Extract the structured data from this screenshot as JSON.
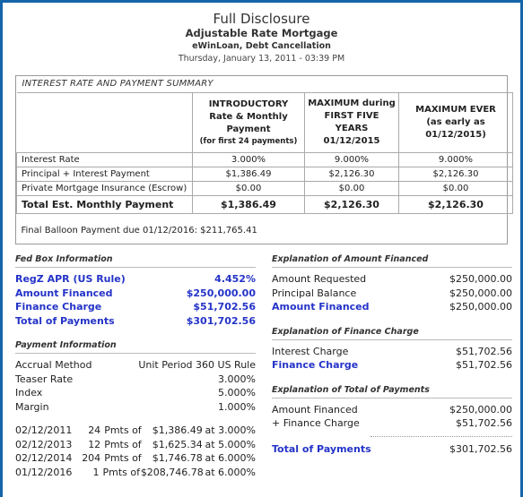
{
  "document": {
    "title": "Full Disclosure",
    "subtitle": "Adjustable Rate Mortgage",
    "company": "eWinLoan, Debt Cancellation",
    "date": "Thursday, January 13, 2011 - 03:39 PM"
  },
  "accent_color": "#2433c8",
  "frame_color": "#1565a8",
  "summary": {
    "section_title": "INTEREST RATE AND PAYMENT SUMMARY",
    "headers": {
      "blank": "",
      "introductory": {
        "line1": "INTRODUCTORY",
        "line2": "Rate & Monthly",
        "line3": "Payment",
        "note": "(for first 24 payments)"
      },
      "first_five": {
        "line1": "MAXIMUM during",
        "line2": "FIRST FIVE",
        "line3": "YEARS",
        "line4": "01/12/2015"
      },
      "maximum_ever": {
        "line1": "MAXIMUM EVER",
        "line2": "(as early as",
        "line3": "01/12/2015)"
      }
    },
    "rows": [
      {
        "label": "Interest Rate",
        "introductory": "3.000%",
        "first_five": "9.000%",
        "maximum_ever": "9.000%"
      },
      {
        "label": "Principal + Interest Payment",
        "introductory": "$1,386.49",
        "first_five": "$2,126.30",
        "maximum_ever": "$2,126.30"
      },
      {
        "label": "Private Mortgage Insurance (Escrow)",
        "introductory": "$0.00",
        "first_five": "$0.00",
        "maximum_ever": "$0.00"
      },
      {
        "label": "Total Est. Monthly Payment",
        "introductory": "$1,386.49",
        "first_five": "$2,126.30",
        "maximum_ever": "$2,126.30"
      }
    ],
    "balloon": "Final Balloon Payment due 01/12/2016: $211,765.41"
  },
  "fed_box": {
    "heading": "Fed Box Information",
    "items": [
      {
        "label": "RegZ APR (US Rule)",
        "value": "4.452%"
      },
      {
        "label": "Amount Financed",
        "value": "$250,000.00"
      },
      {
        "label": "Finance Charge",
        "value": "$51,702.56"
      },
      {
        "label": "Total of Payments",
        "value": "$301,702.56"
      }
    ]
  },
  "payment_info": {
    "heading": "Payment Information",
    "items": [
      {
        "label": "Accrual Method",
        "value": "Unit Period 360 US Rule"
      },
      {
        "label": "Teaser Rate",
        "value": "3.000%"
      },
      {
        "label": "Index",
        "value": "5.000%"
      },
      {
        "label": "Margin",
        "value": "1.000%"
      }
    ]
  },
  "schedule": {
    "of_label": "Pmts of",
    "rows": [
      {
        "date": "02/12/2011",
        "count": "24",
        "of": "Pmts of",
        "amount": "$1,386.49",
        "rate": "at 3.000%"
      },
      {
        "date": "02/12/2013",
        "count": "12",
        "of": "Pmts of",
        "amount": "$1,625.34",
        "rate": "at 5.000%"
      },
      {
        "date": "02/12/2014",
        "count": "204",
        "of": "Pmts of",
        "amount": "$1,746.78",
        "rate": "at 6.000%"
      },
      {
        "date": "01/12/2016",
        "count": "1",
        "of": "Pmts of",
        "amount": "$208,746.78",
        "rate": "at 6.000%"
      }
    ]
  },
  "explain_amount_financed": {
    "heading": "Explanation of Amount Financed",
    "items": [
      {
        "label": "Amount Requested",
        "value": "$250,000.00"
      },
      {
        "label": "Principal Balance",
        "value": "$250,000.00"
      },
      {
        "label": "Amount Financed",
        "value": "$250,000.00"
      }
    ]
  },
  "explain_finance_charge": {
    "heading": "Explanation of Finance Charge",
    "items": [
      {
        "label": "Interest Charge",
        "value": "$51,702.56"
      },
      {
        "label": "Finance Charge",
        "value": "$51,702.56"
      }
    ]
  },
  "explain_total_payments": {
    "heading": "Explanation of Total of Payments",
    "items": [
      {
        "label": "Amount Financed",
        "value": "$250,000.00"
      },
      {
        "label": "+ Finance Charge",
        "value": "$51,702.56"
      }
    ],
    "total": {
      "label": "Total of Payments",
      "value": "$301,702.56"
    }
  }
}
